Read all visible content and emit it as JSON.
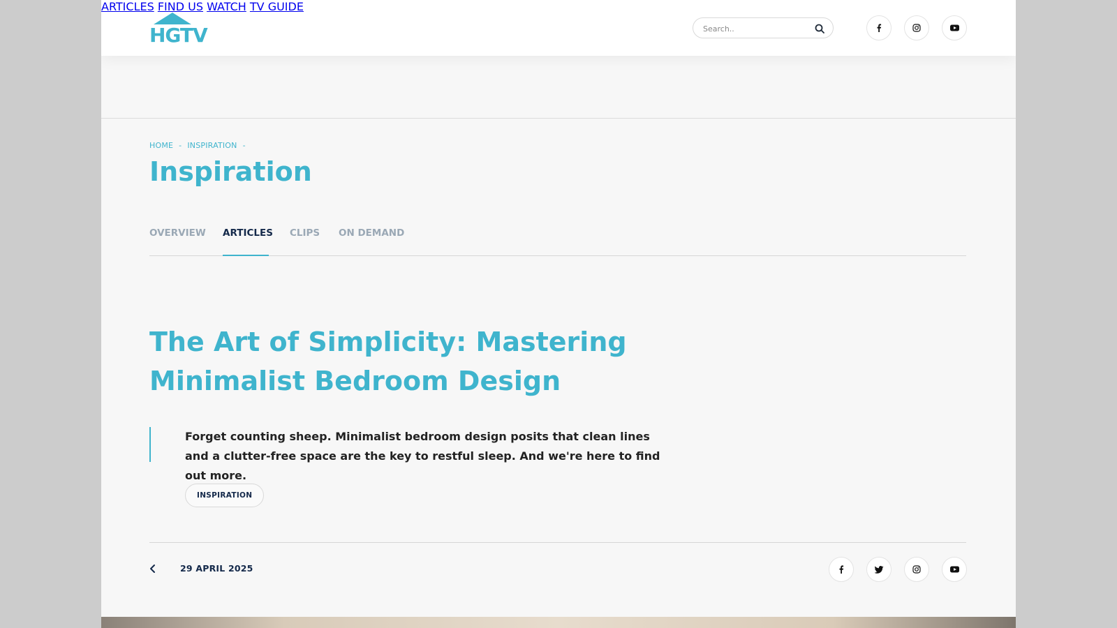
{
  "colors": {
    "accent": "#3fb4cd",
    "navy": "#14294a",
    "muted": "#9aa8b5"
  },
  "header": {
    "logo_text": "HGTV",
    "nav": [
      {
        "label": "ARTICLES"
      },
      {
        "label": "FIND US"
      },
      {
        "label": "WATCH"
      },
      {
        "label": "TV GUIDE"
      }
    ],
    "search": {
      "placeholder": "Search..",
      "icon": "search-icon"
    },
    "social": [
      "facebook-icon",
      "instagram-icon",
      "youtube-icon"
    ]
  },
  "breadcrumb": [
    "HOME",
    "INSPIRATION"
  ],
  "page_title": "Inspiration",
  "tabs": [
    {
      "label": "OVERVIEW",
      "active": false
    },
    {
      "label": "ARTICLES",
      "active": true
    },
    {
      "label": "CLIPS",
      "active": false
    },
    {
      "label": "ON DEMAND",
      "active": false
    }
  ],
  "article": {
    "title": "The Art of Simplicity: Mastering Minimalist Bedroom Design",
    "lead": "Forget counting sheep. Minimalist bedroom design posits that clean lines and a clutter-free space are the key to restful sleep. And we're here to find out more.",
    "tag": "INSPIRATION",
    "date": "29 APRIL 2025",
    "share": [
      "facebook-icon",
      "twitter-icon",
      "instagram-icon",
      "youtube-icon"
    ]
  }
}
